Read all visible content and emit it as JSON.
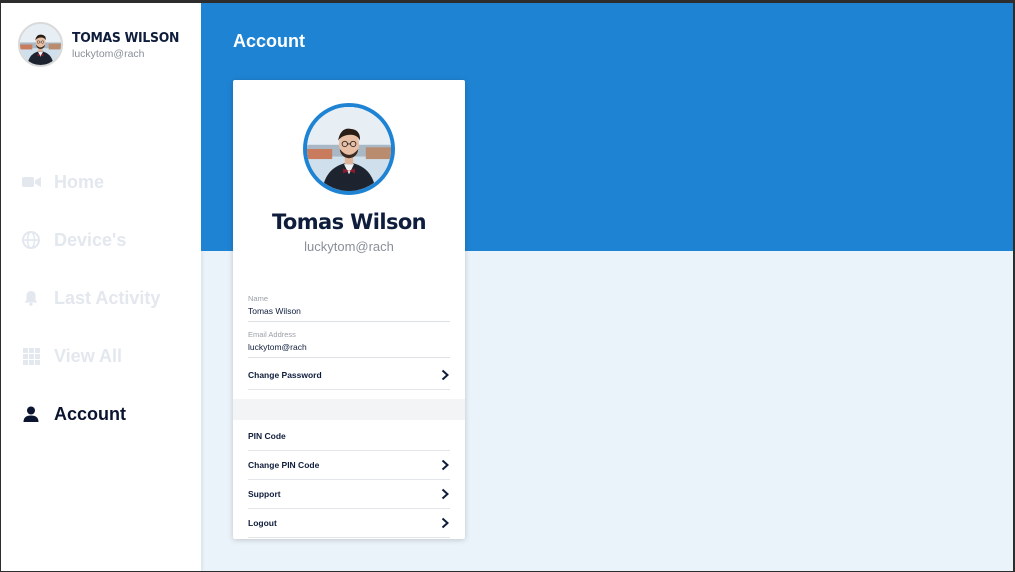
{
  "user": {
    "name_upper": "TOMAS WILSON",
    "name": "Tomas Wilson",
    "email": "luckytom@rach"
  },
  "nav": {
    "items": [
      {
        "label": "Home",
        "icon": "video-icon"
      },
      {
        "label": "Device's",
        "icon": "globe-icon"
      },
      {
        "label": "Last Activity",
        "icon": "bell-icon"
      },
      {
        "label": "View All",
        "icon": "grid-icon"
      },
      {
        "label": "Account",
        "icon": "user-icon",
        "active": true
      }
    ]
  },
  "page": {
    "title": "Account"
  },
  "fields": {
    "name_label": "Name",
    "name_value": "Tomas Wilson",
    "email_label": "Email Address",
    "email_value": "luckytom@rach"
  },
  "rows": {
    "change_password": "Change Password",
    "pin_code": "PIN Code",
    "change_pin": "Change PIN Code",
    "support": "Support",
    "logout": "Logout"
  },
  "colors": {
    "accent": "#1f83d3",
    "navy": "#0f1d3c",
    "background": "#eaf2fa"
  }
}
